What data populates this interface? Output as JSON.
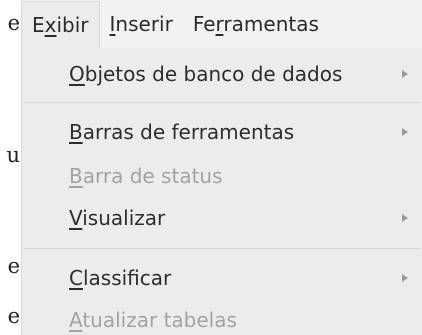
{
  "background_text": {
    "chars": [
      "e",
      "u",
      "e",
      "e"
    ]
  },
  "menubar": {
    "items": [
      {
        "pre": "E",
        "mn": "x",
        "post": "ibir"
      },
      {
        "pre": "",
        "mn": "I",
        "post": "nserir"
      },
      {
        "pre": "Fe",
        "mn": "r",
        "post": "ramentas"
      }
    ]
  },
  "menu": {
    "items": [
      {
        "pre": "",
        "mn": "O",
        "post": "bjetos de banco de dados",
        "submenu": true,
        "disabled": false
      },
      {
        "pre": "",
        "mn": "B",
        "post": "arras de ferramentas",
        "submenu": true,
        "disabled": false
      },
      {
        "pre": "",
        "mn": "B",
        "post": "arra de status",
        "submenu": false,
        "disabled": true
      },
      {
        "pre": "",
        "mn": "V",
        "post": "isualizar",
        "submenu": true,
        "disabled": false
      },
      {
        "pre": "",
        "mn": "C",
        "post": "lassificar",
        "submenu": true,
        "disabled": false
      },
      {
        "pre": "",
        "mn": "A",
        "post": "tualizar tabelas",
        "submenu": false,
        "disabled": true
      }
    ]
  },
  "colors": {
    "menu_bg": "#ececec",
    "menubar_bg": "#f2f2f2",
    "text": "#2d2d2d",
    "disabled_text": "#a3a3a3"
  }
}
